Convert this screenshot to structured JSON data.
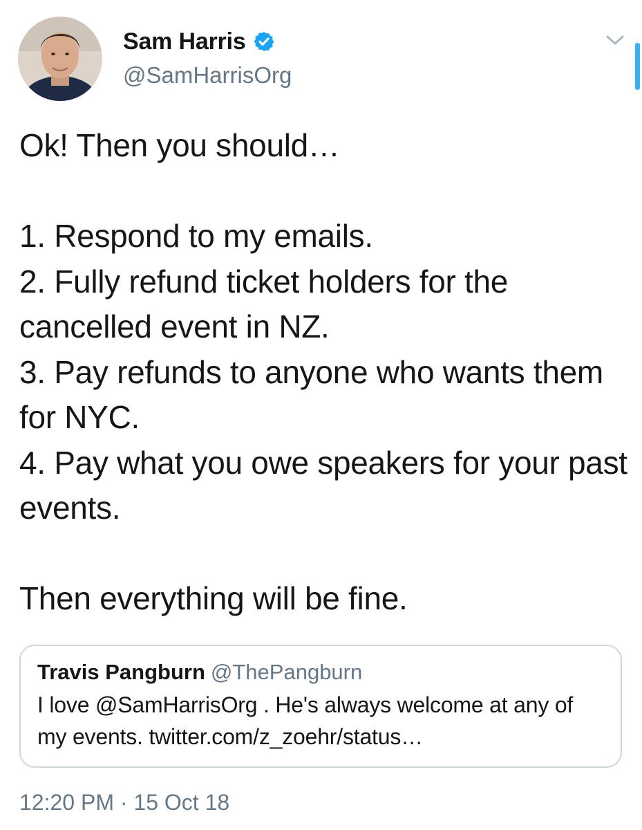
{
  "author": {
    "name": "Sam Harris",
    "handle": "@SamHarrisOrg",
    "verified": true,
    "avatar_icon": "profile-photo"
  },
  "tweet": {
    "text": "Ok! Then you should…\n\n1. Respond to my emails.\n2. Fully refund ticket holders for the cancelled event in NZ.\n3. Pay refunds to anyone who wants them for NYC.\n4. Pay what you owe speakers for your past events.\n\nThen everything will be fine."
  },
  "quoted_tweet": {
    "name": "Travis Pangburn",
    "handle": "@ThePangburn",
    "text": "I love @SamHarrisOrg . He's always welcome at any of my events. twitter.com/z_zoehr/status…"
  },
  "meta": {
    "timestamp": "12:20 PM · 15 Oct 18"
  },
  "icons": {
    "verified": "verified-badge-icon",
    "menu": "chevron-down-icon"
  },
  "colors": {
    "text": "#14171a",
    "secondary": "#657786",
    "accent": "#1da1f2",
    "border": "#ccd6dd"
  }
}
